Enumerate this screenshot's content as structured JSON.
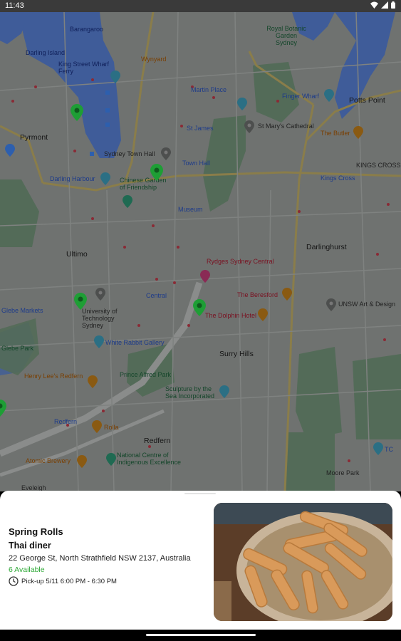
{
  "status_bar": {
    "time": "11:43",
    "icons": [
      "wifi-icon",
      "signal-icon",
      "battery-icon"
    ]
  },
  "map": {
    "labels": {
      "darling_harbour_water": "Darling Harbour",
      "barangaroo": "Barangaroo",
      "darling_island": "Darling Island",
      "king_street_wharf": "King Street Wharf Ferry",
      "wynyard": "Wynyard",
      "royal_botanic_garden": "Royal Botanic Garden Sydney",
      "pyrmont": "Pyrmont",
      "martin_place": "Martin Place",
      "finger_wharf": "Finger Wharf",
      "potts_point": "Potts Point",
      "st_james": "St James",
      "st_marys": "St Mary's Cathedral",
      "the_butler": "The Butler",
      "sydney_town_hall": "Sydney Town Hall",
      "town_hall": "Town Hall",
      "kings_cross": "KINGS CROSS",
      "darling_harbour": "Darling Harbour",
      "chinese_garden": "Chinese Garden of Friendship",
      "kings_cross_station": "Kings Cross",
      "museum": "Museum",
      "darlinghurst": "Darlinghurst",
      "ultimo": "Ultimo",
      "rydges": "Rydges Sydney Central",
      "the_beresford": "The Beresford",
      "central": "Central",
      "glebe_markets": "Glebe Markets",
      "uts": "University of Technology Sydney",
      "dolphin_hotel": "The Dolphin Hotel",
      "unsw_art": "UNSW Art & Design",
      "surry_hills": "Surry Hills",
      "white_rabbit": "White Rabbit Gallery",
      "prince_alfred_park": "Prince Alfred Park",
      "henry_lees": "Henry Lee's Redfern",
      "sculpture": "Sculpture by the Sea Incorporated",
      "redfern_station": "Redfern",
      "rolla": "Rolla",
      "redfern": "Redfern",
      "national_centre": "National Centre of Indigenous Excellence",
      "moore_park": "Moore Park",
      "tc": "TC",
      "atomic_brewery": "Atomic Brewery",
      "eveleigh": "Eveleigh",
      "glebe_park": "Glebe Park"
    }
  },
  "listing": {
    "item_name": "Spring Rolls",
    "store_name": "Thai diner",
    "address": "22 George St, North Strathfield NSW 2137, Australia",
    "availability": "6 Available",
    "pickup": "Pick-up 5/11 6:00 PM - 6:30 PM",
    "image_alt": "Spring rolls on a plate"
  },
  "colors": {
    "available_green": "#2ea836",
    "pin_green": "#1e9e35",
    "scrim": "#6f7270"
  }
}
